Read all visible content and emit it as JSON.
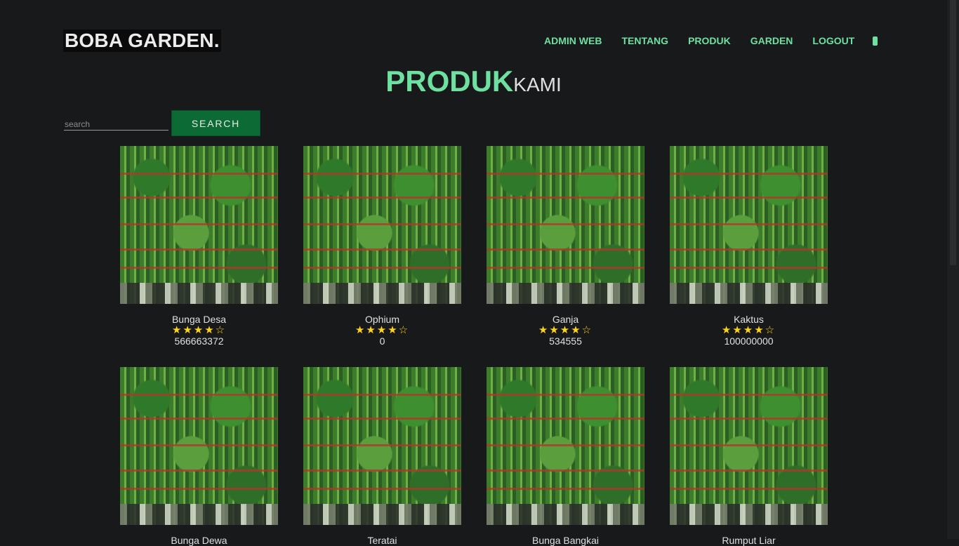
{
  "brand": "BOBA GARDEN.",
  "nav": {
    "items": [
      "ADMIN WEB",
      "TENTANG",
      "PRODUK",
      "GARDEN",
      "LOGOUT"
    ],
    "icon": "phone-icon"
  },
  "heading": {
    "big": "PRODUK",
    "small": "KAMI"
  },
  "search": {
    "placeholder": "search",
    "value": "",
    "button": "SEARCH"
  },
  "products": [
    {
      "name": "Bunga Desa",
      "stars": "★★★★☆",
      "rating": 4,
      "price": "566663372"
    },
    {
      "name": "Ophium",
      "stars": "★★★★☆",
      "rating": 4,
      "price": "0"
    },
    {
      "name": "Ganja",
      "stars": "★★★★☆",
      "rating": 4,
      "price": "534555"
    },
    {
      "name": "Kaktus",
      "stars": "★★★★☆",
      "rating": 4,
      "price": "100000000"
    },
    {
      "name": "Bunga Dewa",
      "stars": "",
      "rating": null,
      "price": ""
    },
    {
      "name": "Teratai",
      "stars": "",
      "rating": null,
      "price": ""
    },
    {
      "name": "Bunga Bangkai",
      "stars": "",
      "rating": null,
      "price": ""
    },
    {
      "name": "Rumput Liar",
      "stars": "",
      "rating": null,
      "price": ""
    }
  ],
  "colors": {
    "accent": "#6ee0a0",
    "button": "#0c6a34",
    "background": "#18191b",
    "star": "#ffd21f"
  }
}
